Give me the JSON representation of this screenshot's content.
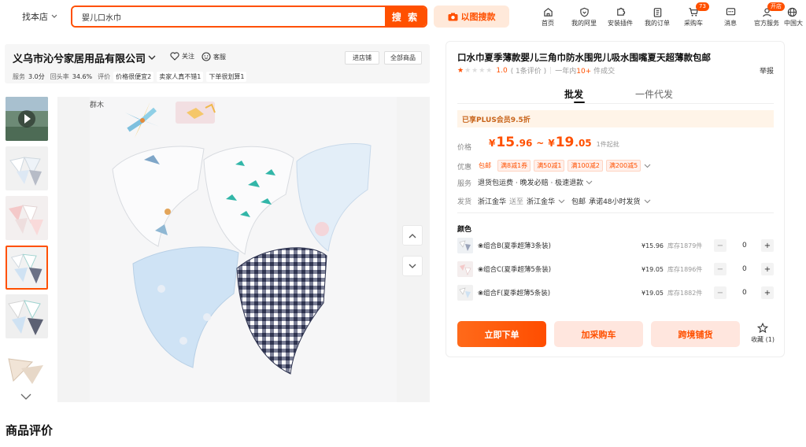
{
  "topbar": {
    "store_find": "找本店",
    "search_value": "婴儿口水巾",
    "search_button": "搜 索",
    "image_search": "以图搜款",
    "nav": [
      {
        "label": "首页",
        "icon": "home-icon"
      },
      {
        "label": "我的阿里",
        "icon": "heart-shield-icon"
      },
      {
        "label": "安装插件",
        "icon": "puzzle-icon"
      },
      {
        "label": "我的订单",
        "icon": "clipboard-icon"
      },
      {
        "label": "采购车",
        "icon": "cart-icon",
        "badge": "73"
      },
      {
        "label": "消息",
        "icon": "message-icon"
      },
      {
        "label": "官方服务",
        "icon": "user-icon",
        "badge": "开店"
      },
      {
        "label": "中国大",
        "icon": "globe-icon"
      }
    ]
  },
  "shop": {
    "name": "义乌市沁兮家居用品有限公司",
    "follow": "关注",
    "service": "客服",
    "enter_shop": "进店铺",
    "all_products": "全部商品",
    "stats": {
      "service_label": "服务",
      "service_value": "3.0分",
      "repeat_label": "回头率",
      "repeat_value": "34.6%",
      "eval_label": "评价",
      "tags": [
        "价格很便宜2",
        "卖家人真不错1",
        "下单很划算1"
      ]
    }
  },
  "gallery": {
    "watermark": "群木",
    "thumbnail_count": 6,
    "active_index": 3
  },
  "reviews_title": "商品评价",
  "product": {
    "title": "口水巾夏季薄款婴儿三角巾防水围兜儿吸水围嘴夏天超薄款包邮",
    "rating": "1.0",
    "rating_count": "( 1条评价 )",
    "sales": "一年内10+ 件成交",
    "sales_prefix": "一年内",
    "sales_num": "10+",
    "sales_suffix": "件成交",
    "report": "举报",
    "tabs": [
      "批发",
      "一件代发"
    ],
    "plus_bar": "已享PLUS会员9.5折",
    "price_label": "价格",
    "price_low_int": "15",
    "price_low_dec": ".96",
    "price_tilde": "~",
    "price_high_int": "19",
    "price_high_dec": ".05",
    "currency": "¥",
    "min_order": "1件起批",
    "promo_label": "优惠",
    "promos": [
      "包邮",
      "满8减1券",
      "满50减1",
      "满100减2",
      "满200减5"
    ],
    "service_label": "服务",
    "service_text": "退货包运费 · 晚发必赔 · 极速退款",
    "ship_label": "发货",
    "ship_from": "浙江金华",
    "ship_to_word": "送至",
    "ship_to": "浙江金华",
    "ship_free": "包邮",
    "ship_promise": "承诺48小时发货",
    "color_label": "颜色",
    "variants": [
      {
        "name": "❀组合B(夏季超薄3条装)",
        "price": "¥15.96",
        "stock": "库存1879件",
        "qty": "0"
      },
      {
        "name": "❀组合C(夏季超薄5条装)",
        "price": "¥19.05",
        "stock": "库存1896件",
        "qty": "0"
      },
      {
        "name": "❀组合F(夏季超薄5条装)",
        "price": "¥19.05",
        "stock": "库存1882件",
        "qty": "0"
      }
    ],
    "buy_now": "立即下单",
    "add_cart": "加采购车",
    "cross_border": "跨境铺货",
    "favorite": "收藏 (1)"
  },
  "colors": {
    "accent": "#ff5000",
    "plus_bg": "#fff4e8"
  }
}
